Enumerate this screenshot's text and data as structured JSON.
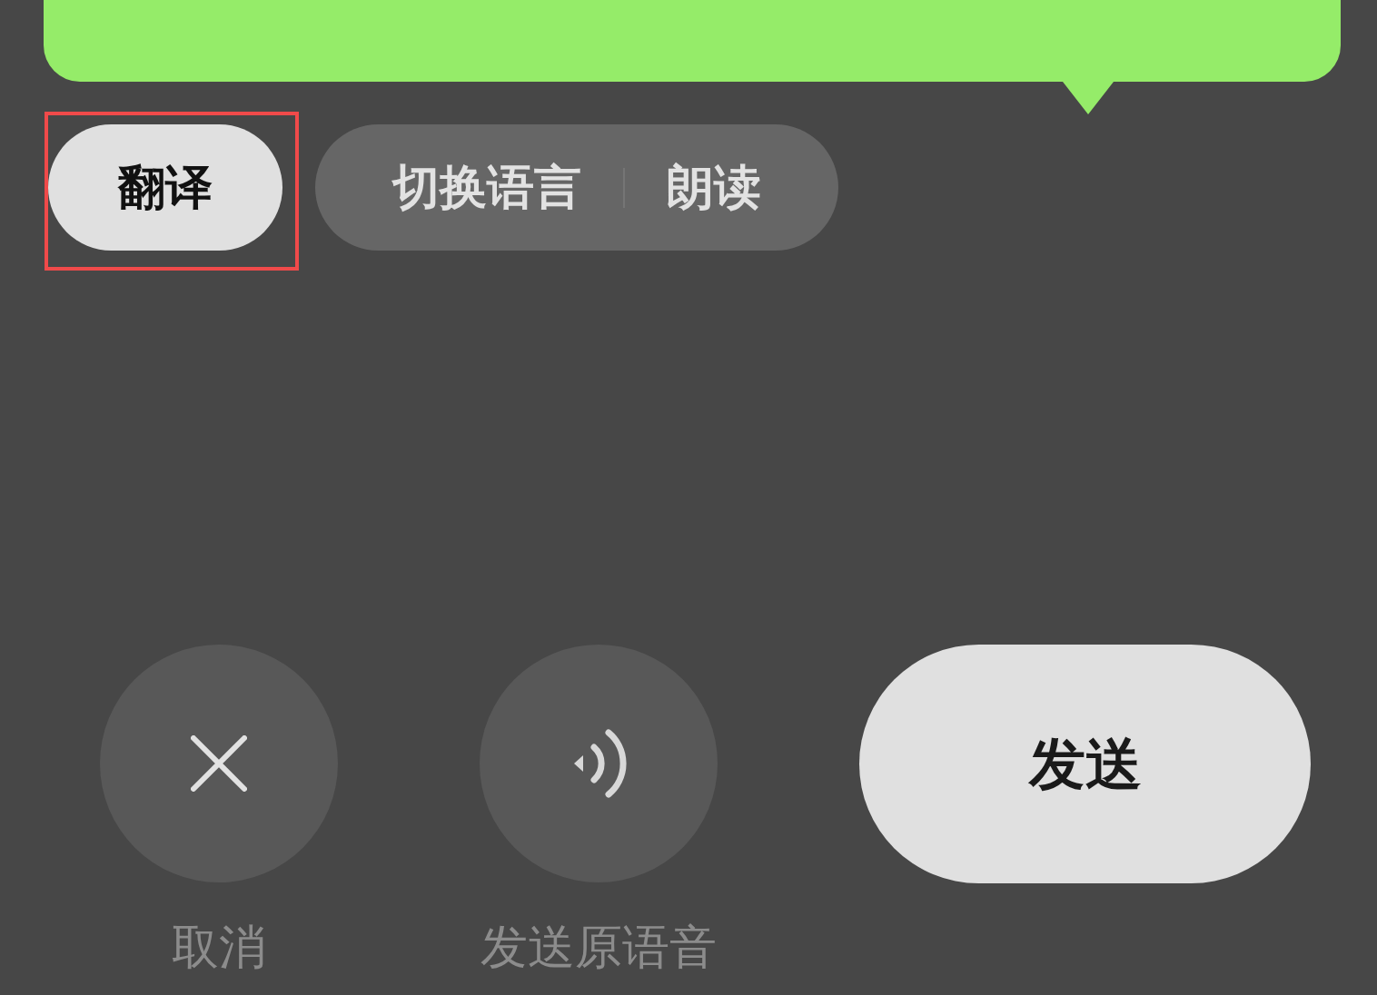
{
  "message_bubble": {
    "kind": "outgoing"
  },
  "pills": [
    {
      "highlighted": true,
      "items": [
        {
          "label": "翻译",
          "selected": true
        }
      ]
    },
    {
      "highlighted": false,
      "items": [
        {
          "label": "切换语言",
          "selected": false
        },
        {
          "label": "朗读",
          "selected": false
        }
      ]
    }
  ],
  "controls": [
    {
      "kind": "cancel",
      "label": "取消"
    },
    {
      "kind": "original_voice",
      "label": "发送原语音"
    },
    {
      "kind": "send",
      "label": "发送"
    }
  ]
}
